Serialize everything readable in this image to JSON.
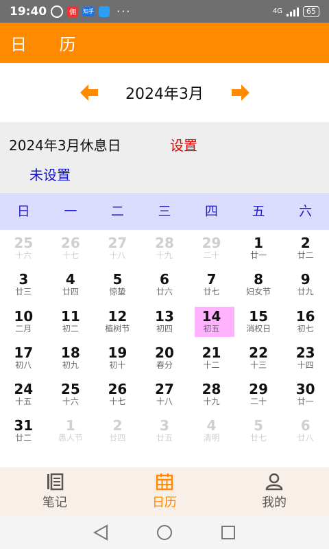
{
  "status_bar": {
    "time": "19:40",
    "app1": "佣",
    "app2": "知乎",
    "more": "···",
    "network": "4G",
    "battery": "65"
  },
  "app_bar": {
    "title": "日 历"
  },
  "month_nav": {
    "title": "2024年3月",
    "prev_icon": "arrow-left-icon",
    "next_icon": "arrow-right-icon"
  },
  "holiday": {
    "title": "2024年3月休息日",
    "set_label": "设置",
    "status": "未设置"
  },
  "weekdays": [
    "日",
    "一",
    "二",
    "三",
    "四",
    "五",
    "六"
  ],
  "calendar": {
    "rows": [
      [
        {
          "d": "25",
          "l": "十六",
          "o": true
        },
        {
          "d": "26",
          "l": "十七",
          "o": true
        },
        {
          "d": "27",
          "l": "十八",
          "o": true
        },
        {
          "d": "28",
          "l": "十九",
          "o": true
        },
        {
          "d": "29",
          "l": "二十",
          "o": true
        },
        {
          "d": "1",
          "l": "廿一"
        },
        {
          "d": "2",
          "l": "廿二"
        }
      ],
      [
        {
          "d": "3",
          "l": "廿三"
        },
        {
          "d": "4",
          "l": "廿四"
        },
        {
          "d": "5",
          "l": "惊蛰"
        },
        {
          "d": "6",
          "l": "廿六"
        },
        {
          "d": "7",
          "l": "廿七"
        },
        {
          "d": "8",
          "l": "妇女节"
        },
        {
          "d": "9",
          "l": "廿九"
        }
      ],
      [
        {
          "d": "10",
          "l": "二月"
        },
        {
          "d": "11",
          "l": "初二"
        },
        {
          "d": "12",
          "l": "植树节"
        },
        {
          "d": "13",
          "l": "初四"
        },
        {
          "d": "14",
          "l": "初五",
          "t": true
        },
        {
          "d": "15",
          "l": "消权日"
        },
        {
          "d": "16",
          "l": "初七"
        }
      ],
      [
        {
          "d": "17",
          "l": "初八"
        },
        {
          "d": "18",
          "l": "初九"
        },
        {
          "d": "19",
          "l": "初十"
        },
        {
          "d": "20",
          "l": "春分"
        },
        {
          "d": "21",
          "l": "十二"
        },
        {
          "d": "22",
          "l": "十三"
        },
        {
          "d": "23",
          "l": "十四"
        }
      ],
      [
        {
          "d": "24",
          "l": "十五"
        },
        {
          "d": "25",
          "l": "十六"
        },
        {
          "d": "26",
          "l": "十七"
        },
        {
          "d": "27",
          "l": "十八"
        },
        {
          "d": "28",
          "l": "十九"
        },
        {
          "d": "29",
          "l": "二十"
        },
        {
          "d": "30",
          "l": "廿一"
        }
      ],
      [
        {
          "d": "31",
          "l": "廿二"
        },
        {
          "d": "1",
          "l": "愚人节",
          "o": true
        },
        {
          "d": "2",
          "l": "廿四",
          "o": true
        },
        {
          "d": "3",
          "l": "廿五",
          "o": true
        },
        {
          "d": "4",
          "l": "清明",
          "o": true
        },
        {
          "d": "5",
          "l": "廿七",
          "o": true
        },
        {
          "d": "6",
          "l": "廿八",
          "o": true
        }
      ]
    ]
  },
  "bottom_nav": {
    "tabs": [
      {
        "label": "笔记",
        "icon": "notes-icon"
      },
      {
        "label": "日历",
        "icon": "calendar-icon",
        "active": true
      },
      {
        "label": "我的",
        "icon": "profile-icon"
      }
    ]
  },
  "colors": {
    "accent": "#ff8a00",
    "today": "#ffb3ff",
    "weekday_bg": "#dcdcff",
    "holiday_set": "#e00000",
    "status_blue": "#1414c8"
  }
}
